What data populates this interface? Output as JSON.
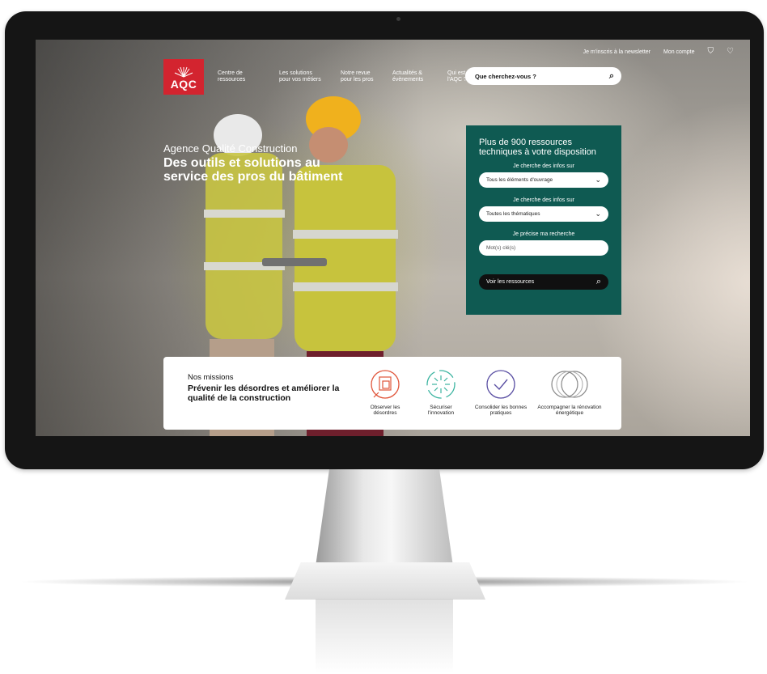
{
  "topbar": {
    "newsletter": "Je m'inscris à la newsletter",
    "account": "Mon compte",
    "basket_icon": "basket-icon",
    "heart_icon": "heart-icon"
  },
  "logo": {
    "text": "AQC"
  },
  "nav": {
    "items": [
      {
        "label": "Centre de ressources"
      },
      {
        "label": "Les solutions pour vos métiers"
      },
      {
        "label": "Notre revue pour les pros"
      },
      {
        "label": "Actualités & évènements"
      },
      {
        "label": "Qui est l'AQC ?"
      }
    ]
  },
  "search": {
    "placeholder": "Que cherchez-vous ?"
  },
  "hero": {
    "subtitle": "Agence Qualité Construction",
    "title": "Des outils et solutions au service des pros du bâtiment"
  },
  "panel": {
    "title": "Plus de 900 ressources techniques à votre disposition",
    "label1": "Je cherche des infos sur",
    "select1": "Tous les éléments d'ouvrage",
    "label2": "Je cherche des infos sur",
    "select2": "Toutes les thématiques",
    "label3": "Je précise ma recherche",
    "keyword_placeholder": "Mot(s) clé(s)",
    "button": "Voir les ressources"
  },
  "missions": {
    "label": "Nos missions",
    "title": "Prévenir les désordres et améliorer la qualité de la construction",
    "items": [
      {
        "label": "Observer les désordres",
        "color": "#e0553a"
      },
      {
        "label": "Sécuriser l'innovation",
        "color": "#3bb4a0"
      },
      {
        "label": "Consolider les bonnes pratiques",
        "color": "#5a4fa3"
      },
      {
        "label": "Accompagner la rénovation énergétique",
        "color": "#888888"
      }
    ]
  },
  "colors": {
    "brand": "#d3242f",
    "panel": "#0f5a52"
  }
}
